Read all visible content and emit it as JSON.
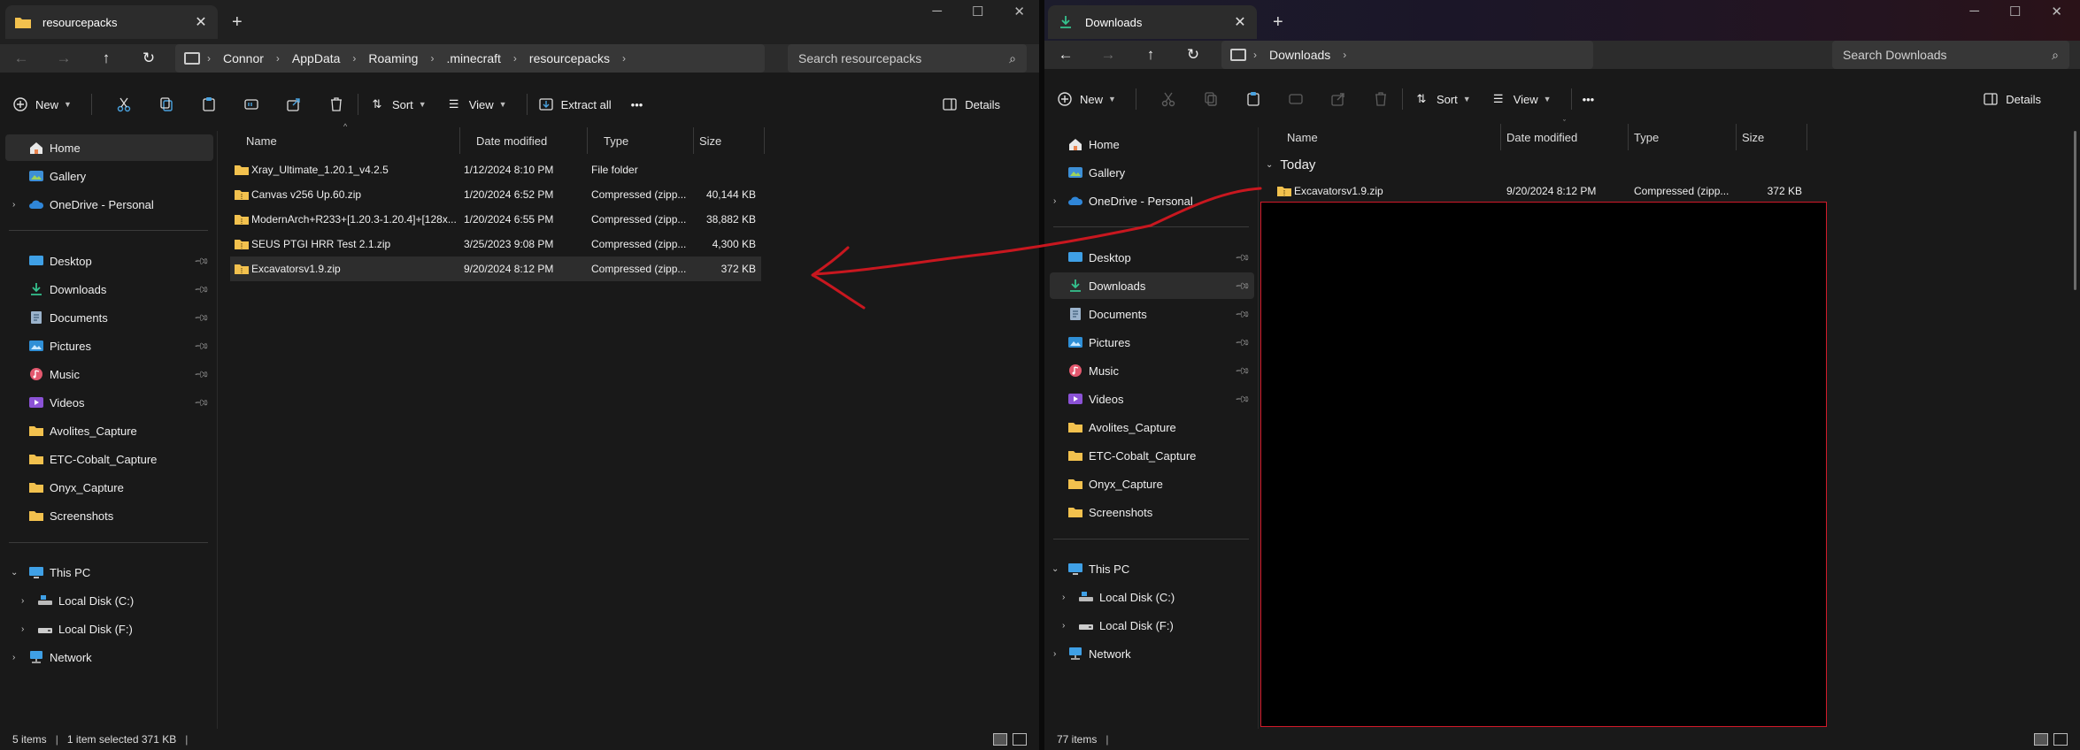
{
  "left": {
    "tab_title": "resourcepacks",
    "breadcrumb": [
      "Connor",
      "AppData",
      "Roaming",
      ".minecraft",
      "resourcepacks"
    ],
    "search_placeholder": "Search resourcepacks",
    "commands": {
      "new": "New",
      "sort": "Sort",
      "view": "View",
      "extract": "Extract all",
      "more": "•••",
      "details": "Details"
    },
    "nav": {
      "home": "Home",
      "gallery": "Gallery",
      "onedrive": "OneDrive - Personal",
      "desktop": "Desktop",
      "downloads": "Downloads",
      "documents": "Documents",
      "pictures": "Pictures",
      "music": "Music",
      "videos": "Videos",
      "avolites": "Avolites_Capture",
      "etc": "ETC-Cobalt_Capture",
      "onyx": "Onyx_Capture",
      "screenshots": "Screenshots",
      "thispc": "This PC",
      "diskc": "Local Disk (C:)",
      "diskf": "Local Disk (F:)",
      "network": "Network"
    },
    "columns": {
      "name": "Name",
      "date": "Date modified",
      "type": "Type",
      "size": "Size"
    },
    "files": [
      {
        "name": "Xray_Ultimate_1.20.1_v4.2.5",
        "date": "1/12/2024 8:10 PM",
        "type": "File folder",
        "size": ""
      },
      {
        "name": "Canvas v256 Up.60.zip",
        "date": "1/20/2024 6:52 PM",
        "type": "Compressed (zipp...",
        "size": "40,144 KB"
      },
      {
        "name": "ModernArch+R233+[1.20.3-1.20.4]+[128x...",
        "date": "1/20/2024 6:55 PM",
        "type": "Compressed (zipp...",
        "size": "38,882 KB"
      },
      {
        "name": "SEUS PTGI HRR Test 2.1.zip",
        "date": "3/25/2023 9:08 PM",
        "type": "Compressed (zipp...",
        "size": "4,300 KB"
      },
      {
        "name": "Excavatorsv1.9.zip",
        "date": "9/20/2024 8:12 PM",
        "type": "Compressed (zipp...",
        "size": "372 KB"
      }
    ],
    "status": {
      "items": "5 items",
      "selected": "1 item selected  371 KB",
      "end": "|"
    }
  },
  "right": {
    "tab_title": "Downloads",
    "breadcrumb": [
      "Downloads"
    ],
    "search_placeholder": "Search Downloads",
    "commands": {
      "new": "New",
      "sort": "Sort",
      "view": "View",
      "more": "•••",
      "details": "Details"
    },
    "nav": {
      "home": "Home",
      "gallery": "Gallery",
      "onedrive": "OneDrive - Personal",
      "desktop": "Desktop",
      "downloads": "Downloads",
      "documents": "Documents",
      "pictures": "Pictures",
      "music": "Music",
      "videos": "Videos",
      "avolites": "Avolites_Capture",
      "etc": "ETC-Cobalt_Capture",
      "onyx": "Onyx_Capture",
      "screenshots": "Screenshots",
      "thispc": "This PC",
      "diskc": "Local Disk (C:)",
      "diskf": "Local Disk (F:)",
      "network": "Network"
    },
    "columns": {
      "name": "Name",
      "date": "Date modified",
      "type": "Type",
      "size": "Size"
    },
    "group": "Today",
    "files": [
      {
        "name": "Excavatorsv1.9.zip",
        "date": "9/20/2024 8:12 PM",
        "type": "Compressed (zipp...",
        "size": "372 KB"
      }
    ],
    "status": {
      "items": "77 items",
      "end": "|"
    }
  },
  "colors": {
    "folder": "#f2c14e",
    "selection": "#2d2d2d",
    "accent_red": "#d21a2a"
  }
}
